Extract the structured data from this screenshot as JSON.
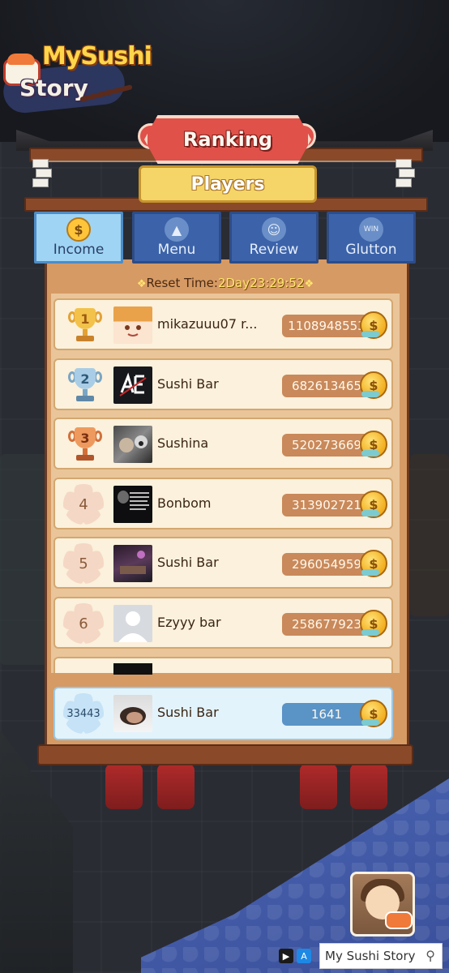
{
  "logo": {
    "line1": "MySushi",
    "line2": "Story"
  },
  "header": {
    "ranking_title": "Ranking",
    "players_label": "Players"
  },
  "tabs": [
    {
      "label": "Income",
      "icon": "coin-hand-icon",
      "active": true
    },
    {
      "label": "Menu",
      "icon": "cloche-icon",
      "active": false
    },
    {
      "label": "Review",
      "icon": "smiley-icon",
      "active": false
    },
    {
      "label": "Glutton",
      "icon": "win-stopwatch-icon",
      "active": false
    }
  ],
  "reset": {
    "label": "Reset Time:",
    "time": "2Day23:29:52"
  },
  "rows": [
    {
      "rank": "1",
      "name": "mikazuuu07 r...",
      "score": "1108948553",
      "badge": "gold-trophy"
    },
    {
      "rank": "2",
      "name": "Sushi Bar",
      "score": "682613465",
      "badge": "silver-trophy"
    },
    {
      "rank": "3",
      "name": "Sushina",
      "score": "520273669",
      "badge": "bronze-trophy"
    },
    {
      "rank": "4",
      "name": "Bonbom",
      "score": "313902721",
      "badge": "flower"
    },
    {
      "rank": "5",
      "name": "Sushi Bar",
      "score": "296054959",
      "badge": "flower"
    },
    {
      "rank": "6",
      "name": "Ezyyy bar",
      "score": "258677923",
      "badge": "flower"
    }
  ],
  "me": {
    "rank": "33443",
    "name": "Sushi Bar",
    "score": "1641"
  },
  "ad": {
    "label": "My Sushi Story"
  },
  "colors": {
    "accent_red": "#e0514a",
    "tab_active": "#9fd4f4",
    "tab_inactive": "#3c63a9",
    "score_pill": "#c9895a",
    "my_score_pill": "#5a93c6"
  }
}
